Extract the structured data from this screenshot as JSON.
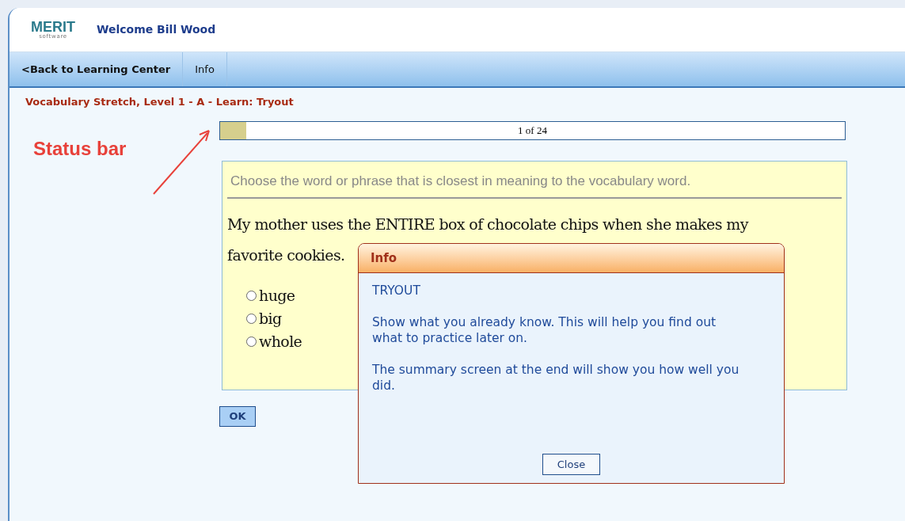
{
  "header": {
    "logo": "MERIT",
    "logo_sub": "software",
    "welcome": "Welcome Bill Wood"
  },
  "nav": [
    {
      "label": "<Back to Learning Center",
      "bold": true
    },
    {
      "label": "Info",
      "bold": false
    }
  ],
  "lesson_title": "Vocabulary Stretch, Level 1 - A - Learn: Tryout",
  "progress": {
    "level": 0.042,
    "reading": "1 of 24"
  },
  "annotation": {
    "label": "Status bar"
  },
  "question": {
    "instruction": "Choose the word or phrase that is closest in meaning to the vocabulary word.",
    "sentence_line_1": "My mother uses the ENTIRE box of chocolate chips when she makes my",
    "sentence_line_2": "favorite cookies.",
    "options": [
      {
        "label": "huge",
        "selected": false
      },
      {
        "label": "big",
        "selected": false
      },
      {
        "label": "whole",
        "selected": false
      }
    ]
  },
  "ok_button": "OK",
  "dialog": {
    "title": "Info",
    "heading": "TRYOUT",
    "paragraphs": [
      "Show what you already know. This will help you find out what to practice later on.",
      "The summary screen at the end will show you how well you did."
    ],
    "close_button": "Close"
  }
}
